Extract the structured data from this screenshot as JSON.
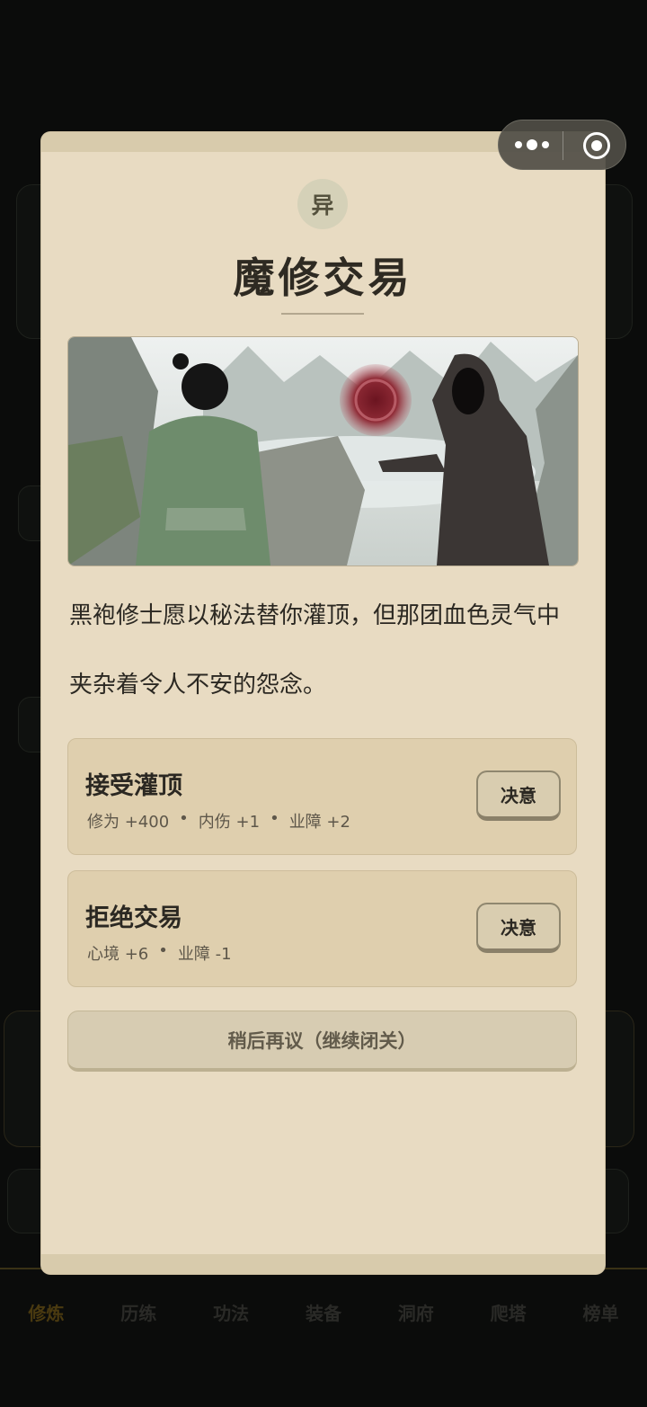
{
  "bottom_nav": [
    "修炼",
    "历练",
    "功法",
    "装备",
    "洞府",
    "爬塔",
    "榜单"
  ],
  "modal": {
    "badge": "异",
    "title": "魔修交易",
    "story_lines": [
      "黑袍修士愿以秘法替你灌顶，但那团血色灵气中",
      "夹杂着令人不安的怨念。"
    ],
    "choices": [
      {
        "title": "接受灌顶",
        "effects": [
          "修为 +400",
          "内伤 +1",
          "业障 +2"
        ],
        "button": "决意"
      },
      {
        "title": "拒绝交易",
        "effects": [
          "心境 +6",
          "业障 -1"
        ],
        "button": "决意"
      }
    ],
    "later_button": "稍后再议（继续闭关）"
  },
  "colors": {
    "modal_bg": "#e8dbc2",
    "choice_bg": "#dfcfae",
    "accent_text": "#2e2a22"
  },
  "icons": [
    "more-dots-icon",
    "close-target-icon"
  ]
}
